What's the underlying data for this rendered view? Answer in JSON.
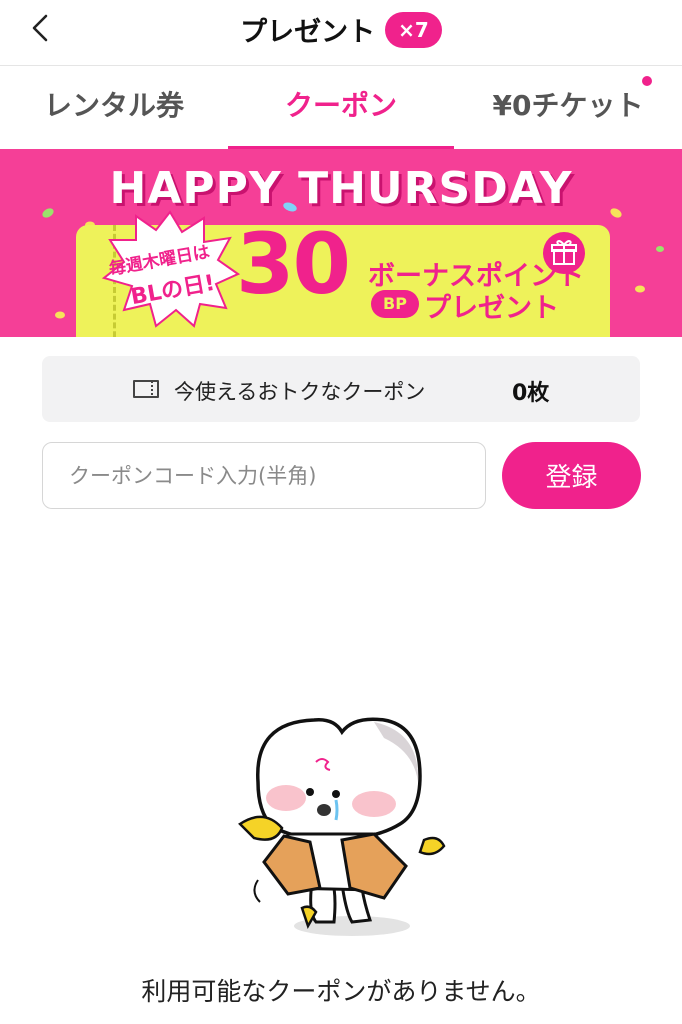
{
  "header": {
    "back_icon": "chevron-left-icon",
    "title": "プレゼント",
    "count_badge": "×7"
  },
  "tabs": [
    {
      "label": "レンタル券",
      "active": false
    },
    {
      "label": "クーポン",
      "active": true
    },
    {
      "label": "¥0チケット",
      "active": false,
      "has_notification_dot": true
    }
  ],
  "banner": {
    "headline": "HAPPY THURSDAY",
    "burst_line1": "毎週木曜日は",
    "burst_line2": "BLの日!",
    "big_number": "30",
    "bonus_line1": "ボーナスポイント",
    "bp_badge": "BP",
    "bonus_line2": "プレゼント",
    "gift_icon": "gift-icon"
  },
  "summary": {
    "icon": "ticket-icon",
    "label": "今使えるおトクなクーポン",
    "count": "0枚"
  },
  "coupon_code": {
    "placeholder": "クーポンコード入力(半角)",
    "value": "",
    "register_label": "登録"
  },
  "empty_state": {
    "message": "利用可能なクーポンがありません。"
  },
  "colors": {
    "accent": "#f0228c",
    "banner_bg": "#f53f97",
    "ticket_yellow": "#eef25a",
    "summary_bg": "#f2f2f3"
  }
}
